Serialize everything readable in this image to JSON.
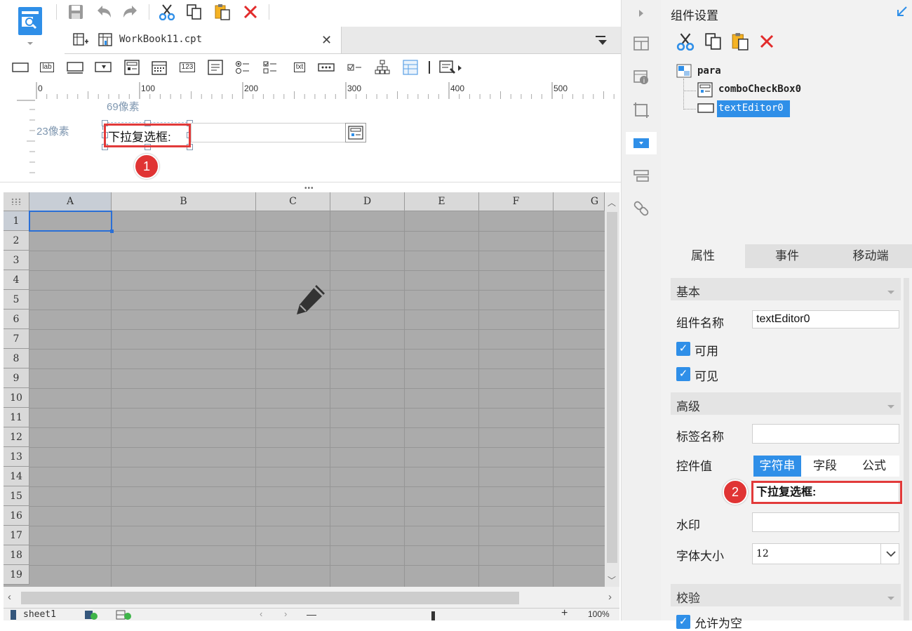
{
  "document_tab": {
    "name": "WorkBook11.cpt"
  },
  "canvas": {
    "dim_top": "69像素",
    "dim_left": "23像素",
    "label_text": "下拉复选框:",
    "marker1": "1"
  },
  "ruler": {
    "ticks": [
      "0",
      "100",
      "200",
      "300",
      "400",
      "500"
    ]
  },
  "widget_toolbar": {
    "label_icon_text": "lab",
    "number_icon_text": "123",
    "text_icon_text": "txt"
  },
  "grid": {
    "columns": [
      "A",
      "B",
      "C",
      "D",
      "E",
      "F",
      "G"
    ],
    "rows": [
      "1",
      "2",
      "3",
      "4",
      "5",
      "6",
      "7",
      "8",
      "9",
      "10",
      "11",
      "12",
      "13",
      "14",
      "15",
      "16",
      "17",
      "18",
      "19"
    ]
  },
  "sheetbar": {
    "sheet_name": "sheet1",
    "zoom": "100%"
  },
  "panel": {
    "title": "组件设置",
    "tree": {
      "root": "para",
      "children": [
        "comboCheckBox0",
        "textEditor0"
      ]
    },
    "tabs": [
      "属性",
      "事件",
      "移动端"
    ],
    "sections": {
      "basic": "基本",
      "advanced": "高级",
      "validate": "校验"
    },
    "widget_name_label": "组件名称",
    "widget_name_value": "textEditor0",
    "enabled_label": "可用",
    "visible_label": "可见",
    "tag_name_label": "标签名称",
    "tag_name_value": "",
    "control_value_label": "控件值",
    "value_types": [
      "字符串",
      "字段",
      "公式"
    ],
    "control_value": "下拉复选框:",
    "watermark_label": "水印",
    "watermark_value": "",
    "font_size_label": "字体大小",
    "font_size_value": "12",
    "allow_empty_label": "允许为空",
    "marker2": "2"
  },
  "colors": {
    "accent": "#2f8fe8",
    "highlight": "#e23a3a",
    "grid_bg": "#ababab"
  }
}
